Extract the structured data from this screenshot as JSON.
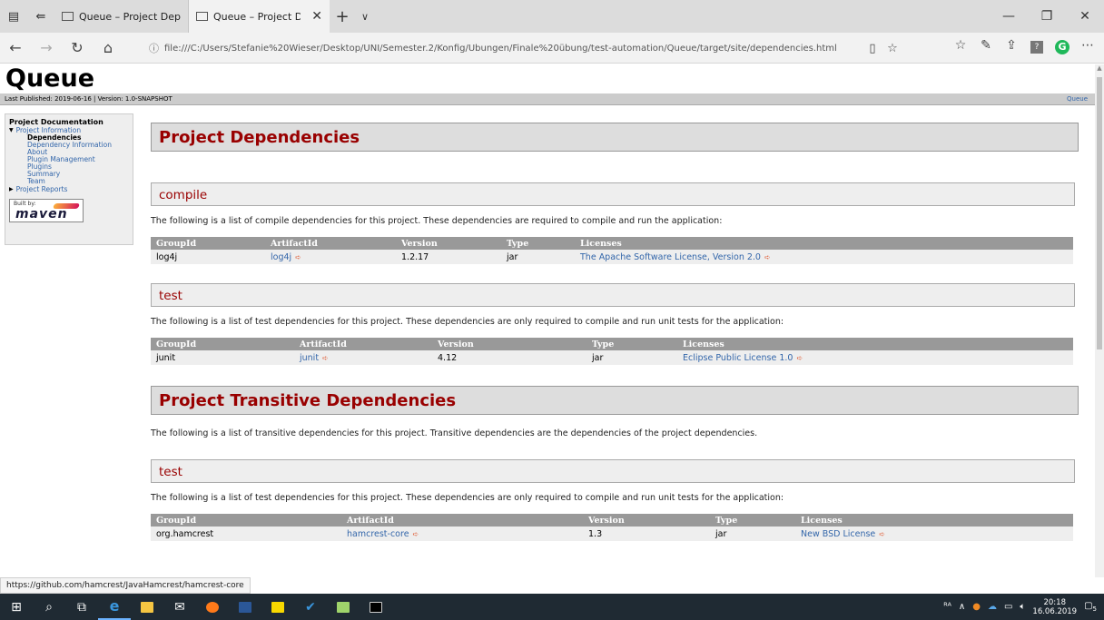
{
  "browser": {
    "tabs": [
      {
        "title": "Queue – Project Dependenc",
        "active": false
      },
      {
        "title": "Queue – Project Depen",
        "active": true
      }
    ],
    "url": "file:///C:/Users/Stefanie%20Wieser/Desktop/UNI/Semester.2/Konfig/Übungen/Finale%20übung/test-automation/Queue/target/site/dependencies.html",
    "icons": {
      "back": "arrow-left-icon",
      "forward": "arrow-right-icon",
      "refresh": "refresh-icon",
      "home": "home-icon"
    }
  },
  "site": {
    "title": "Queue",
    "published": "Last Published: 2019-06-16  | Version: 1.0-SNAPSHOT",
    "breadcrumb_right": "Queue"
  },
  "nav": {
    "heading": "Project Documentation",
    "project_information": "Project Information",
    "items": [
      {
        "label": "Dependencies",
        "current": true
      },
      {
        "label": "Dependency Information",
        "current": false
      },
      {
        "label": "About",
        "current": false
      },
      {
        "label": "Plugin Management",
        "current": false
      },
      {
        "label": "Plugins",
        "current": false
      },
      {
        "label": "Summary",
        "current": false
      },
      {
        "label": "Team",
        "current": false
      }
    ],
    "project_reports": "Project Reports",
    "built_by": "Built by:",
    "maven": "maven"
  },
  "content": {
    "project_dependencies": "Project Dependencies",
    "compile": {
      "heading": "compile",
      "text": "The following is a list of compile dependencies for this project. These dependencies are required to compile and run the application:",
      "headers": [
        "GroupId",
        "ArtifactId",
        "Version",
        "Type",
        "Licenses"
      ],
      "rows": [
        [
          "log4j",
          "log4j",
          "1.2.17",
          "jar",
          "The Apache Software License, Version 2.0"
        ]
      ]
    },
    "test": {
      "heading": "test",
      "text": "The following is a list of test dependencies for this project. These dependencies are only required to compile and run unit tests for the application:",
      "headers": [
        "GroupId",
        "ArtifactId",
        "Version",
        "Type",
        "Licenses"
      ],
      "rows": [
        [
          "junit",
          "junit",
          "4.12",
          "jar",
          "Eclipse Public License 1.0"
        ]
      ]
    },
    "transitive": "Project Transitive Dependencies",
    "transitive_text": "The following is a list of transitive dependencies for this project. Transitive dependencies are the dependencies of the project dependencies.",
    "trans_test": {
      "heading": "test",
      "text": "The following is a list of test dependencies for this project. These dependencies are only required to compile and run unit tests for the application:",
      "headers": [
        "GroupId",
        "ArtifactId",
        "Version",
        "Type",
        "Licenses"
      ],
      "rows": [
        [
          "org.hamcrest",
          "hamcrest-core",
          "1.3",
          "jar",
          "New BSD License"
        ]
      ]
    }
  },
  "status_url": "https://github.com/hamcrest/JavaHamcrest/hamcrest-core",
  "taskbar": {
    "time": "20:18",
    "date": "16.06.2019",
    "notification_count": "5"
  },
  "colors": {
    "heading_red": "#990000",
    "link_blue": "#3366aa",
    "table_header": "#999999"
  }
}
